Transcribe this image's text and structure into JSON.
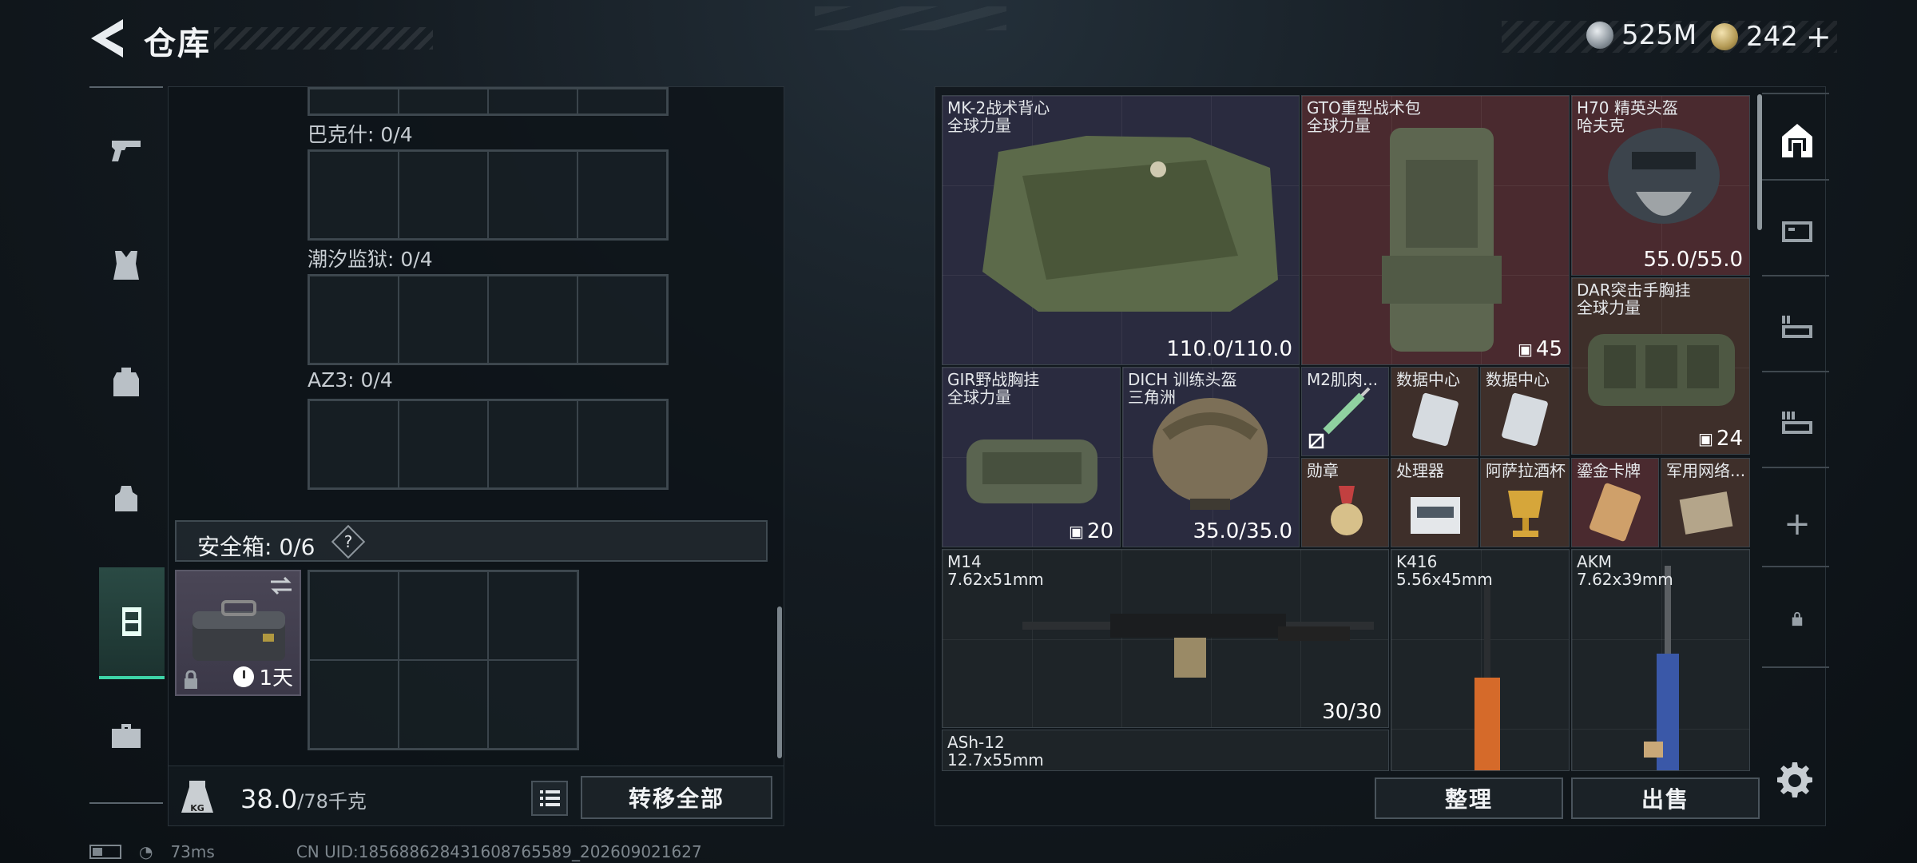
{
  "header": {
    "title": "仓库",
    "currency": [
      {
        "icon": "silver-coin-icon",
        "value": "525M"
      },
      {
        "icon": "gold-coin-icon",
        "value": "242"
      }
    ],
    "add_label": "+"
  },
  "left_nav": {
    "items": [
      {
        "name": "weapons",
        "icon": "pistol-icon"
      },
      {
        "name": "vest",
        "icon": "vest-icon"
      },
      {
        "name": "backpack",
        "icon": "backpack-icon"
      },
      {
        "name": "pouch",
        "icon": "pouch-icon"
      },
      {
        "name": "storage",
        "icon": "locker-icon",
        "active": true
      },
      {
        "name": "toolbox",
        "icon": "toolbox-icon"
      }
    ]
  },
  "containers": [
    {
      "label": "巴克什: 0/4"
    },
    {
      "label": "潮汐监狱: 0/4"
    },
    {
      "label": "AZ3: 0/4"
    }
  ],
  "secure_box": {
    "label": "安全箱: 0/6",
    "help": "?",
    "timer": "1天"
  },
  "footer_left": {
    "weight_current": "38.0",
    "weight_max": "/78千克",
    "kg_badge": "KG",
    "transfer_all": "转移全部"
  },
  "items": [
    {
      "name": "MK-2战术背心",
      "sub": "全球力量",
      "stat": "110.0/110.0"
    },
    {
      "name": "GTO重型战术包",
      "sub": "全球力量",
      "stat": "45"
    },
    {
      "name": "H70 精英头盔",
      "sub": "哈夫克",
      "stat": "55.0/55.0"
    },
    {
      "name": "DAR突击手胸挂",
      "sub": "全球力量",
      "stat": "24"
    },
    {
      "name": "GIR野战胸挂",
      "sub": "全球力量",
      "stat": "20"
    },
    {
      "name": "DICH 训练头盔",
      "sub": "三角洲",
      "stat": "35.0/35.0"
    },
    {
      "name": "M2肌肉..."
    },
    {
      "name": "数据中心"
    },
    {
      "name": "数据中心"
    },
    {
      "name": "勋章"
    },
    {
      "name": "处理器"
    },
    {
      "name": "阿萨拉酒杯"
    },
    {
      "name": "鎏金卡牌"
    },
    {
      "name": "军用网络..."
    },
    {
      "name": "M14",
      "sub": "7.62x51mm",
      "stat": "30/30"
    },
    {
      "name": "K416",
      "sub": "5.56x45mm"
    },
    {
      "name": "AKM",
      "sub": "7.62x39mm"
    },
    {
      "name": "ASh-12",
      "sub": "12.7x55mm"
    }
  ],
  "right_nav": {
    "add": "+"
  },
  "footer_right": {
    "organize": "整理",
    "sell": "出售"
  },
  "status_bar": {
    "ping": "73ms",
    "uid": "CN UID:18568862843160876558​9_202609021627"
  },
  "colors": {
    "accent": "#3ed4a8",
    "rare_red": "#4a2a2f",
    "rare_blue": "#2a2b3f",
    "rare_brown": "#3e2f2a"
  }
}
